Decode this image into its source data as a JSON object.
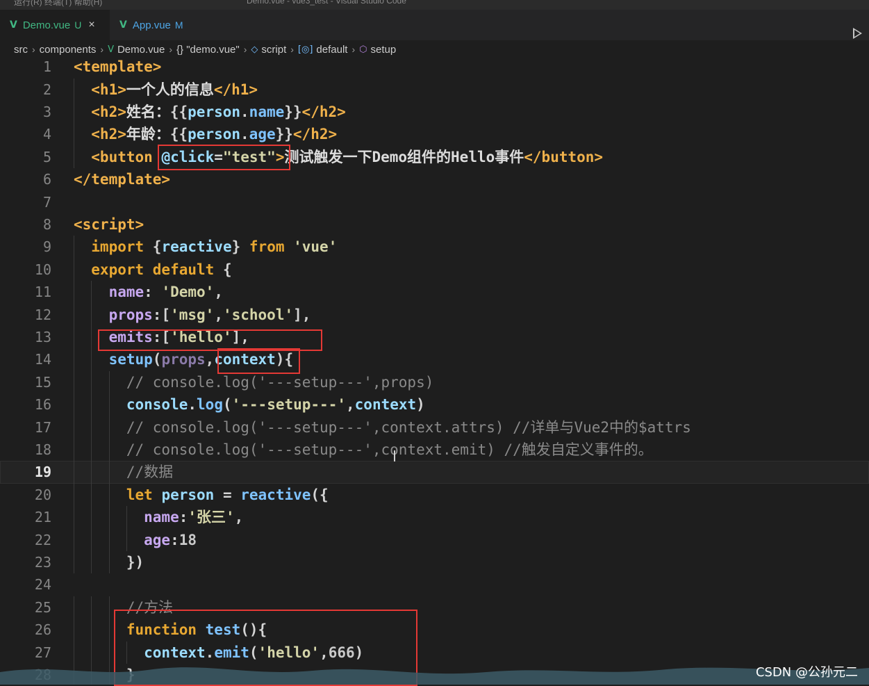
{
  "titlebar": {
    "left_text": "运行(R)   终端(T)   帮助(H)",
    "window_title": "Demo.vue - vue3_test - Visual Studio Code"
  },
  "tabs": [
    {
      "icon": "vue-file-icon",
      "name": "Demo.vue",
      "flag": "U",
      "close": "×",
      "active": true
    },
    {
      "icon": "vue-file-icon",
      "name": "App.vue",
      "flag": "M",
      "active": false
    }
  ],
  "breadcrumb": {
    "items": [
      "src",
      "components",
      "Demo.vue",
      "{} \"demo.vue\"",
      "script",
      "default",
      "setup"
    ],
    "icons": [
      "",
      "",
      "vue-file-icon",
      "",
      "script-symbol-icon",
      "default-symbol-icon",
      "method-symbol-icon"
    ]
  },
  "editor": {
    "current_line": 19,
    "lines": [
      [
        [
          "t-tag",
          "<template>"
        ]
      ],
      [
        [
          "t-tag",
          "  <h1>"
        ],
        [
          "t-txt",
          "一个人的信息"
        ],
        [
          "t-tag",
          "</h1>"
        ]
      ],
      [
        [
          "t-tag",
          "  <h2>"
        ],
        [
          "t-txt",
          "姓名："
        ],
        [
          "t-punc",
          "{{"
        ],
        [
          "t-var",
          "person"
        ],
        [
          "t-punc",
          "."
        ],
        [
          "t-fn",
          "name"
        ],
        [
          "t-punc",
          "}}"
        ],
        [
          "t-tag",
          "</h2>"
        ]
      ],
      [
        [
          "t-tag",
          "  <h2>"
        ],
        [
          "t-txt",
          "年龄："
        ],
        [
          "t-punc",
          "{{"
        ],
        [
          "t-var",
          "person"
        ],
        [
          "t-punc",
          "."
        ],
        [
          "t-fn",
          "age"
        ],
        [
          "t-punc",
          "}}"
        ],
        [
          "t-tag",
          "</h2>"
        ]
      ],
      [
        [
          "t-tag",
          "  <button "
        ],
        [
          "t-var",
          "@click"
        ],
        [
          "t-punc",
          "="
        ],
        [
          "t-str",
          "\"test\""
        ],
        [
          "t-tag",
          ">"
        ],
        [
          "t-txt",
          "测试触发一下Demo组件的Hello事件"
        ],
        [
          "t-tag",
          "</button>"
        ]
      ],
      [
        [
          "t-tag",
          "</template>"
        ]
      ],
      [],
      [
        [
          "t-tag",
          "<script>"
        ]
      ],
      [
        [
          "t-key",
          "  import "
        ],
        [
          "t-punc",
          "{"
        ],
        [
          "t-var",
          "reactive"
        ],
        [
          "t-punc",
          "} "
        ],
        [
          "t-key",
          "from "
        ],
        [
          "t-str",
          "'vue'"
        ]
      ],
      [
        [
          "t-key",
          "  export default "
        ],
        [
          "t-punc",
          "{"
        ]
      ],
      [
        [
          "t-prop",
          "    name"
        ],
        [
          "t-punc",
          ": "
        ],
        [
          "t-str",
          "'Demo'"
        ],
        [
          "t-punc",
          ","
        ]
      ],
      [
        [
          "t-prop",
          "    props"
        ],
        [
          "t-punc",
          ":["
        ],
        [
          "t-str",
          "'msg'"
        ],
        [
          "t-punc",
          ","
        ],
        [
          "t-str",
          "'school'"
        ],
        [
          "t-punc",
          "],"
        ]
      ],
      [
        [
          "t-prop",
          "    emits"
        ],
        [
          "t-punc",
          ":["
        ],
        [
          "t-str",
          "'hello'"
        ],
        [
          "t-punc",
          "],"
        ]
      ],
      [
        [
          "t-fn",
          "    setup"
        ],
        [
          "t-punc",
          "("
        ],
        [
          "t-mut",
          "props"
        ],
        [
          "t-punc",
          ","
        ],
        [
          "t-var",
          "context"
        ],
        [
          "t-punc",
          "){"
        ]
      ],
      [
        [
          "t-cm",
          "      // console.log('---setup---',props)"
        ]
      ],
      [
        [
          "t-var",
          "      console"
        ],
        [
          "t-punc",
          "."
        ],
        [
          "t-fn",
          "log"
        ],
        [
          "t-punc",
          "("
        ],
        [
          "t-str",
          "'---setup---'"
        ],
        [
          "t-punc",
          ","
        ],
        [
          "t-var",
          "context"
        ],
        [
          "t-punc",
          ")"
        ]
      ],
      [
        [
          "t-cm",
          "      // console.log('---setup---',context.attrs) //详单与Vue2中的$attrs"
        ]
      ],
      [
        [
          "t-cm",
          "      // console.log('---setup---',context.emit) //触发自定义事件的。"
        ]
      ],
      [
        [
          "t-cm",
          "      //数据"
        ]
      ],
      [
        [
          "t-key",
          "      let "
        ],
        [
          "t-var",
          "person "
        ],
        [
          "t-punc",
          "= "
        ],
        [
          "t-fn",
          "reactive"
        ],
        [
          "t-punc",
          "({"
        ]
      ],
      [
        [
          "t-prop",
          "        name"
        ],
        [
          "t-punc",
          ":"
        ],
        [
          "t-str",
          "'张三'"
        ],
        [
          "t-punc",
          ","
        ]
      ],
      [
        [
          "t-prop",
          "        age"
        ],
        [
          "t-punc",
          ":"
        ],
        [
          "t-num",
          "18"
        ]
      ],
      [
        [
          "t-punc",
          "      })"
        ]
      ],
      [],
      [
        [
          "t-cm",
          "      //方法"
        ]
      ],
      [
        [
          "t-key",
          "      function "
        ],
        [
          "t-fn",
          "test"
        ],
        [
          "t-punc",
          "(){"
        ]
      ],
      [
        [
          "t-var",
          "        context"
        ],
        [
          "t-punc",
          "."
        ],
        [
          "t-fn",
          "emit"
        ],
        [
          "t-punc",
          "("
        ],
        [
          "t-str",
          "'hello'"
        ],
        [
          "t-punc",
          ","
        ],
        [
          "t-num",
          "666"
        ],
        [
          "t-punc",
          ")"
        ]
      ],
      [
        [
          "t-punc",
          "      }"
        ]
      ]
    ]
  },
  "watermark": "CSDN @公孙元二",
  "colors": {
    "highlight_box": "#e53935",
    "editor_bg": "#1e1e1e"
  }
}
